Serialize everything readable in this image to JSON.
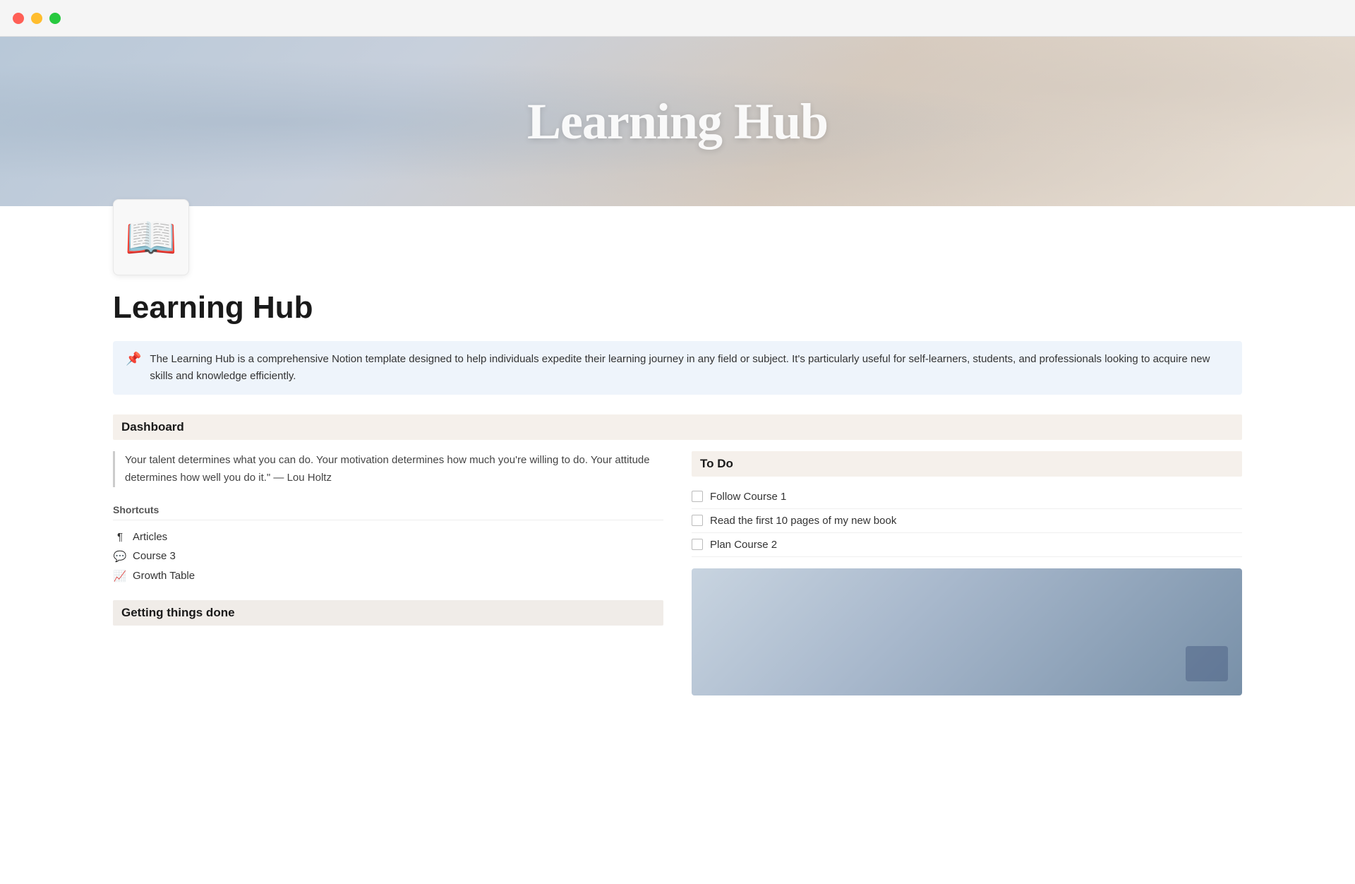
{
  "window": {
    "title": "Learning Hub"
  },
  "traffic_lights": {
    "red_label": "close",
    "yellow_label": "minimize",
    "green_label": "maximize"
  },
  "hero": {
    "title": "Learning Hub"
  },
  "page": {
    "icon": "📖",
    "title": "Learning Hub"
  },
  "callout": {
    "icon": "📌",
    "text": "The Learning Hub is a comprehensive Notion template designed to help individuals expedite their learning journey in any field or subject. It's particularly useful for self-learners, students, and professionals looking to acquire new skills and knowledge efficiently."
  },
  "dashboard": {
    "section_label": "Dashboard"
  },
  "quote": {
    "text": "Your talent determines what you can do. Your motivation determines how much you're willing to do. Your attitude determines how well you do it.\" — Lou Holtz"
  },
  "shortcuts": {
    "label": "Shortcuts",
    "items": [
      {
        "icon": "¶",
        "label": "Articles"
      },
      {
        "icon": "💬",
        "label": "Course 3"
      },
      {
        "icon": "📈",
        "label": "Growth Table"
      }
    ]
  },
  "getting_done": {
    "label": "Getting things done"
  },
  "todo": {
    "header": "To Do",
    "items": [
      {
        "label": "Follow Course 1",
        "checked": false
      },
      {
        "label": "Read the first 10 pages of my new book",
        "checked": false
      },
      {
        "label": "Plan Course 2",
        "checked": false
      }
    ]
  }
}
